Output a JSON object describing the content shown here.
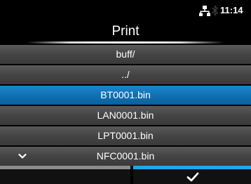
{
  "status_bar": {
    "clock": "11:14",
    "icons": [
      "network-icon",
      "bluetooth-icon"
    ]
  },
  "screen": {
    "title": "Print"
  },
  "file_list": {
    "items": [
      {
        "label": "buff/",
        "selected": false
      },
      {
        "label": "../",
        "selected": false
      },
      {
        "label": "BT0001.bin",
        "selected": true
      },
      {
        "label": "LAN0001.bin",
        "selected": false
      },
      {
        "label": "LPT0001.bin",
        "selected": false
      },
      {
        "label": "NFC0001.bin",
        "selected": false
      }
    ],
    "scroll_indicator_icon": "chevron-down-icon"
  },
  "softkeys": {
    "left": {
      "label": "",
      "accent_color": "#8c8c8c"
    },
    "right": {
      "icon": "checkmark-icon",
      "accent_color": "#1ea7f0"
    }
  },
  "colors": {
    "background": "#000000",
    "row_normal": "#444444",
    "row_selected": "#0f6fb0",
    "text": "#ffffff"
  }
}
